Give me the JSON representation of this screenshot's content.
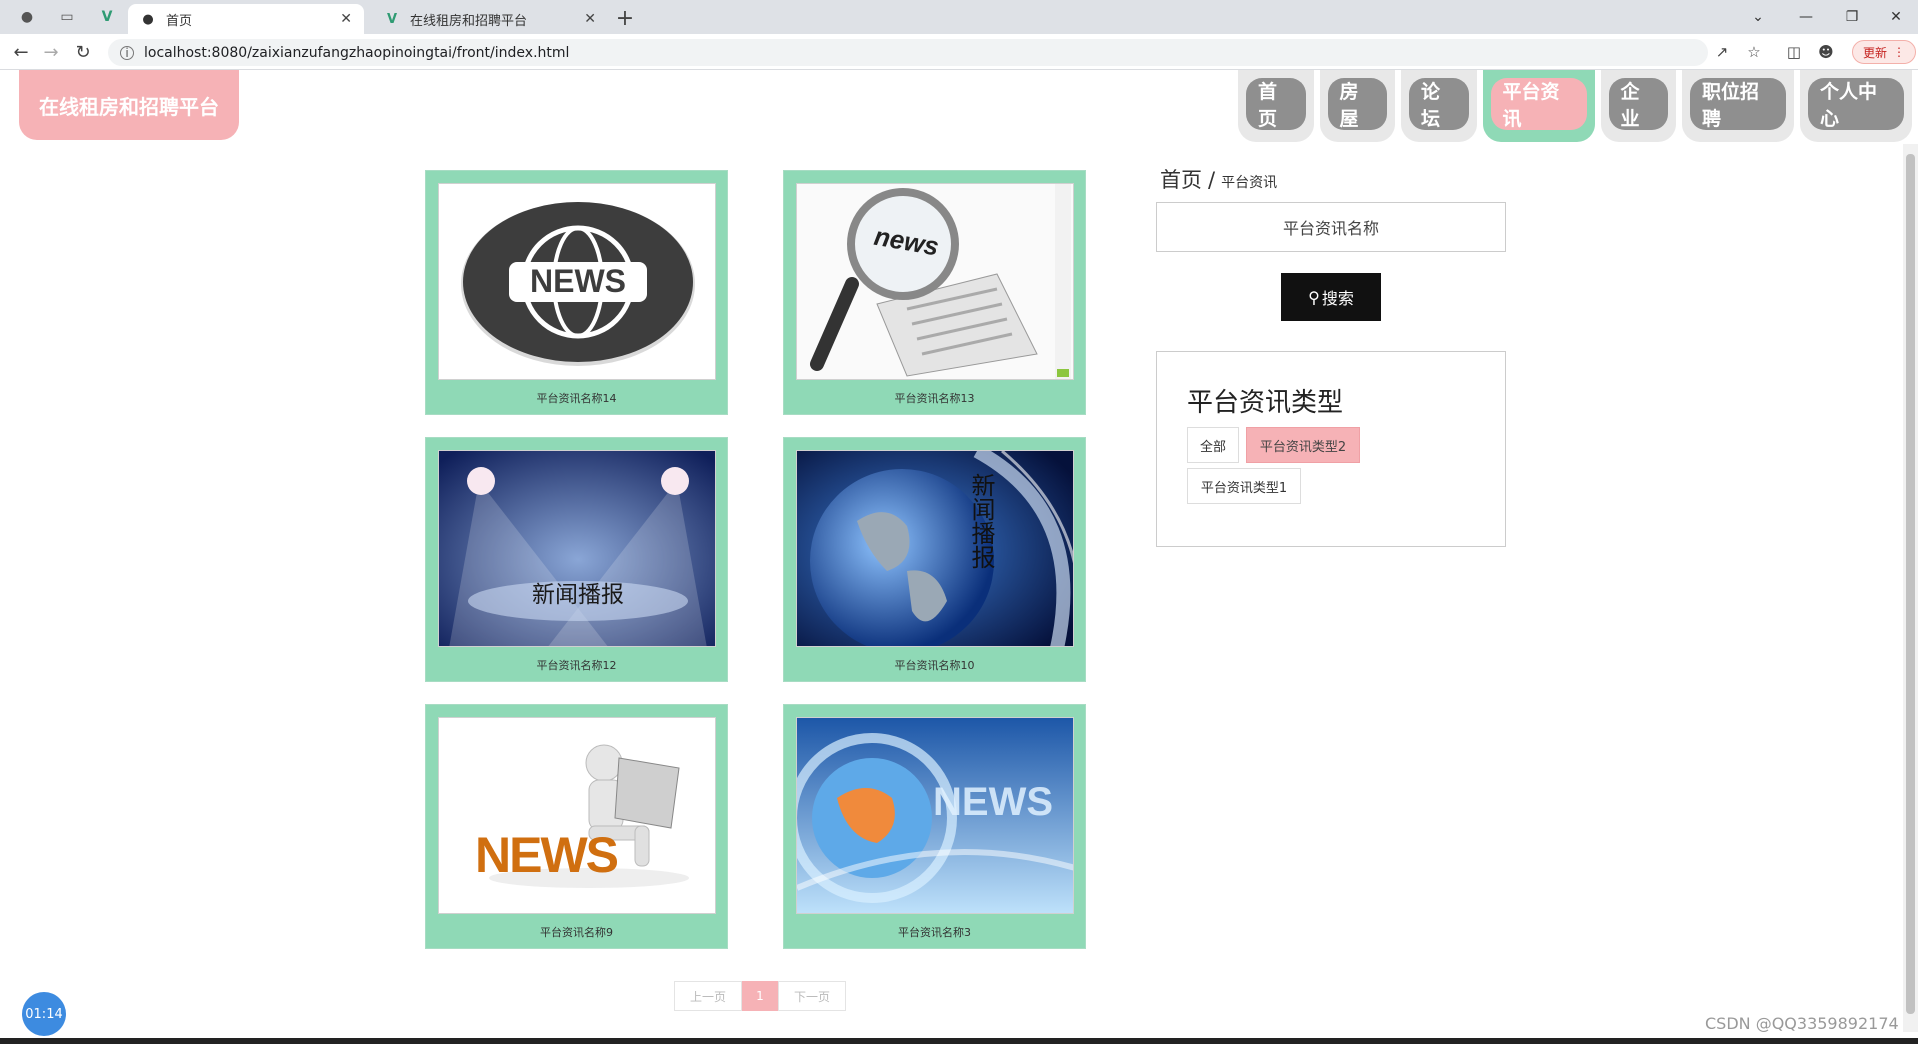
{
  "browser": {
    "tabs": [
      {
        "title": "首页",
        "icon": "globe-icon"
      },
      {
        "title": "在线租房和招聘平台",
        "icon": "vue-icon"
      }
    ],
    "url": "localhost:8080/zaixianzufangzhaopinoingtai/front/index.html",
    "update_label": "更新"
  },
  "site": {
    "logo": "在线租房和招聘平台",
    "nav": [
      "首页",
      "房屋",
      "论坛",
      "平台资讯",
      "企业",
      "职位招聘",
      "个人中心"
    ],
    "nav_active": "平台资讯"
  },
  "cards": [
    {
      "caption": "平台资讯名称14",
      "image": "news-globe-emblem"
    },
    {
      "caption": "平台资讯名称13",
      "image": "magnifier-newspaper"
    },
    {
      "caption": "平台资讯名称12",
      "image": "stage-spotlights",
      "overlay": "新闻播报"
    },
    {
      "caption": "平台资讯名称10",
      "image": "globe-broadcast",
      "overlay": "新闻播报"
    },
    {
      "caption": "平台资讯名称9",
      "image": "person-reading-news",
      "overlay": "NEWS"
    },
    {
      "caption": "平台资讯名称3",
      "image": "blue-globe-news",
      "overlay": "NEWS"
    }
  ],
  "sidebar": {
    "breadcrumb": {
      "home": "首页",
      "sep": "/",
      "current": "平台资讯"
    },
    "search_placeholder": "平台资讯名称",
    "search_label": "搜索",
    "types_title": "平台资讯类型",
    "types": [
      {
        "label": "全部",
        "active": false
      },
      {
        "label": "平台资讯类型2",
        "active": true
      },
      {
        "label": "平台资讯类型1",
        "active": false
      }
    ]
  },
  "pager": {
    "prev": "上一页",
    "page": "1",
    "next": "下一页"
  },
  "timer": "01:14",
  "watermark": "CSDN @QQ3359892174",
  "colors": {
    "green": "#8fd9b6",
    "pink": "#f6b2b6",
    "gray": "#8f8f8f"
  }
}
